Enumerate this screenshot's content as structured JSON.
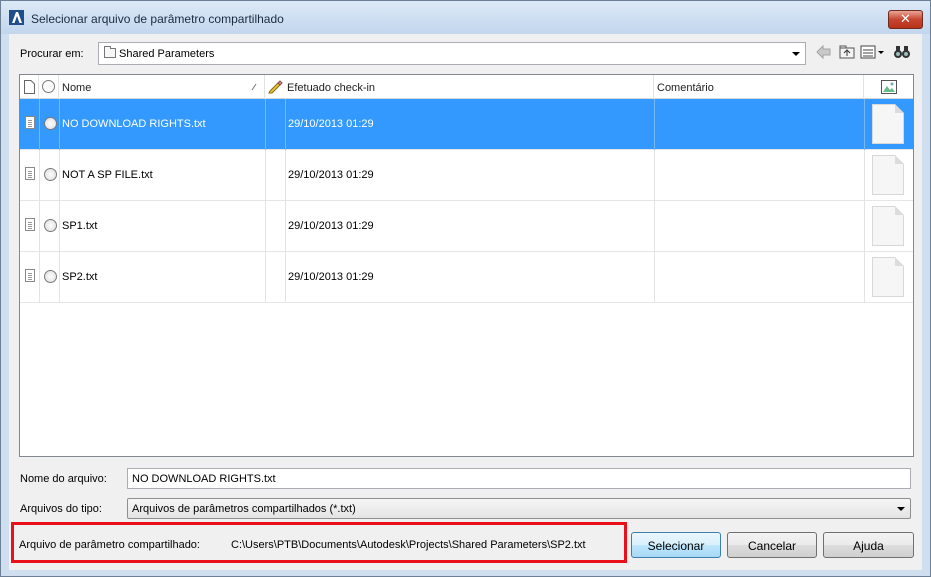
{
  "window": {
    "title": "Selecionar arquivo de parâmetro compartilhado",
    "close_symbol": "✕"
  },
  "lookin": {
    "label": "Procurar em:",
    "value": "Shared Parameters"
  },
  "toolbar": {
    "icons": [
      "back-arrow-icon",
      "up-folder-icon",
      "views-menu-icon",
      "binoculars-icon"
    ]
  },
  "columns": {
    "name": "Nome",
    "checkin": "Efetuado check-in",
    "comment": "Comentário"
  },
  "files": [
    {
      "name": "NO DOWNLOAD RIGHTS.txt",
      "date": "29/10/2013 01:29",
      "selected": true
    },
    {
      "name": "NOT A SP FILE.txt",
      "date": "29/10/2013 01:29",
      "selected": false
    },
    {
      "name": "SP1.txt",
      "date": "29/10/2013 01:29",
      "selected": false
    },
    {
      "name": "SP2.txt",
      "date": "29/10/2013 01:29",
      "selected": false
    }
  ],
  "filename": {
    "label": "Nome do arquivo:",
    "value": "NO DOWNLOAD RIGHTS.txt"
  },
  "filetype": {
    "label": "Arquivos do tipo:",
    "value": "Arquivos de parâmetros compartilhados (*.txt)"
  },
  "shared_file": {
    "label": "Arquivo de parâmetro compartilhado:",
    "path": "C:\\Users\\PTB\\Documents\\Autodesk\\Projects\\Shared Parameters\\SP2.txt"
  },
  "buttons": {
    "select": "Selecionar",
    "cancel": "Cancelar",
    "help": "Ajuda"
  },
  "colors": {
    "selection": "#3399ff",
    "highlight_box": "#e8101a"
  }
}
